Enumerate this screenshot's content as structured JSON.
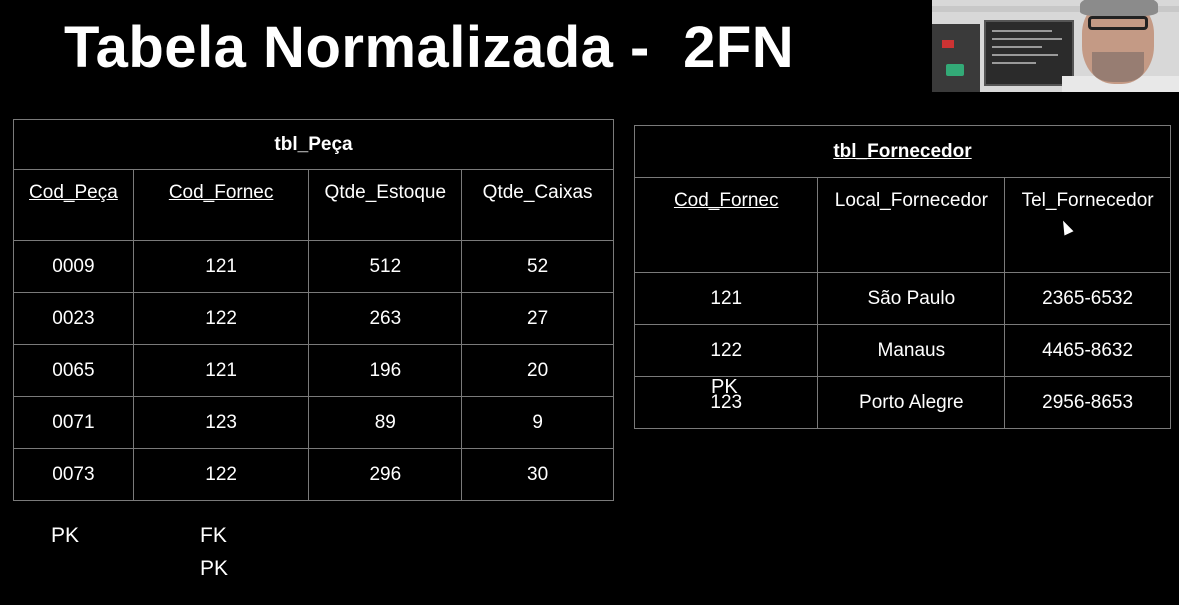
{
  "slide": {
    "title": "Tabela Normalizada -  2FN"
  },
  "tbl_peca": {
    "name": "tbl_Peça",
    "columns": [
      "Cod_Peça",
      "Cod_Fornec",
      "Qtde_Estoque",
      "Qtde_Caixas"
    ],
    "rows": [
      [
        "0009",
        "121",
        "512",
        "52"
      ],
      [
        "0023",
        "122",
        "263",
        "27"
      ],
      [
        "0065",
        "121",
        "196",
        "20"
      ],
      [
        "0071",
        "123",
        "89",
        "9"
      ],
      [
        "0073",
        "122",
        "296",
        "30"
      ]
    ],
    "key_labels": {
      "cod_peca": "PK",
      "cod_fornec_fk": "FK",
      "cod_fornec_pk": "PK"
    }
  },
  "tbl_fornecedor": {
    "name": "tbl_Fornecedor",
    "columns": [
      "Cod_Fornec",
      "Local_Fornecedor",
      "Tel_Fornecedor"
    ],
    "rows": [
      [
        "121",
        "São Paulo",
        "2365-6532"
      ],
      [
        "122",
        "Manaus",
        "4465-8632"
      ],
      [
        "123",
        "Porto Alegre",
        "2956-8653"
      ]
    ],
    "key_label": "PK"
  },
  "webcam": {
    "icon": "presenter-video-icon"
  }
}
